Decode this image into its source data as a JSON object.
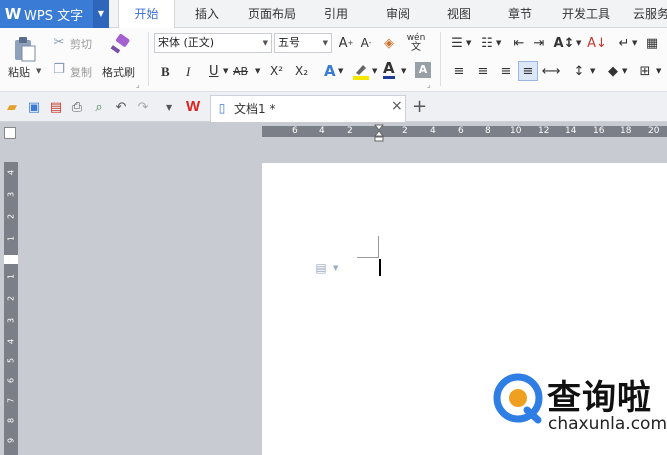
{
  "app": {
    "menu_label": "WPS 文字",
    "logo_letter": "W"
  },
  "tabs": [
    "开始",
    "插入",
    "页面布局",
    "引用",
    "审阅",
    "视图",
    "章节",
    "开发工具",
    "云服务"
  ],
  "active_tab": "开始",
  "clipboard": {
    "paste": "粘贴",
    "cut": "剪切",
    "copy": "复制",
    "format_painter": "格式刷"
  },
  "font": {
    "name": "宋体 (正文)",
    "size": "五号",
    "pinyin": "wén"
  },
  "format_buttons": {
    "bold": "B",
    "italic": "I",
    "underline": "U",
    "strike": "AB",
    "super": "X²",
    "sub": "X₂"
  },
  "document": {
    "tab_title": "文档1 *",
    "close": "×",
    "new": "+"
  },
  "ruler": {
    "top_left_numbers": [
      "6",
      "4",
      "2"
    ],
    "top_right_numbers": [
      "2",
      "4",
      "6",
      "8",
      "10",
      "12",
      "14",
      "16",
      "18",
      "20"
    ],
    "left_top_numbers": [
      "4",
      "3",
      "2",
      "1"
    ],
    "left_bottom_numbers": [
      "1",
      "2",
      "3",
      "4",
      "5",
      "6",
      "7",
      "8",
      "9"
    ]
  },
  "watermark": {
    "brand": "查询啦",
    "url": "chaxunla.com"
  },
  "colors": {
    "accent": "#3a7bd5",
    "font_color": "#1c3d9c",
    "highlight": "#f5e800"
  }
}
